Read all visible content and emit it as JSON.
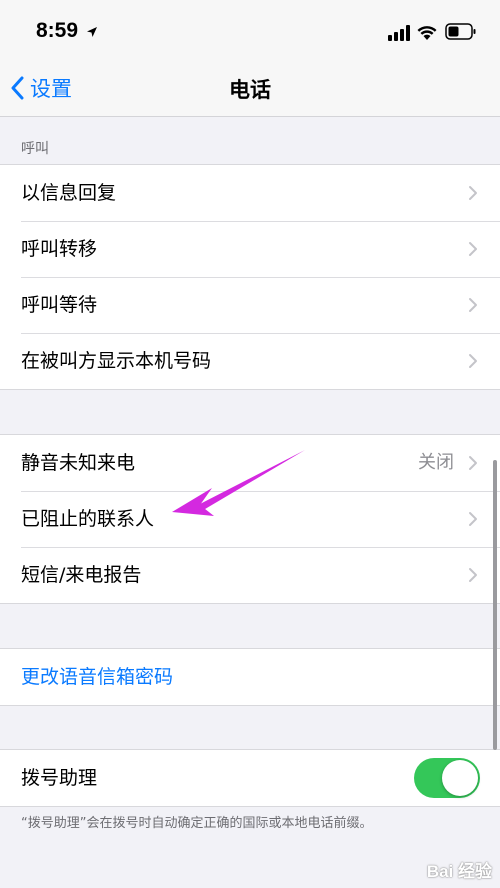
{
  "status": {
    "time": "8:59"
  },
  "nav": {
    "back_label": "设置",
    "title": "电话"
  },
  "section_call": {
    "header": "呼叫",
    "items": [
      {
        "label": "以信息回复"
      },
      {
        "label": "呼叫转移"
      },
      {
        "label": "呼叫等待"
      },
      {
        "label": "在被叫方显示本机号码"
      }
    ]
  },
  "section_block": {
    "items": [
      {
        "label": "静音未知来电",
        "value": "关闭"
      },
      {
        "label": "已阻止的联系人"
      },
      {
        "label": "短信/来电报告"
      }
    ]
  },
  "voicemail": {
    "change_password_label": "更改语音信箱密码"
  },
  "dial_assist": {
    "label": "拨号助理",
    "enabled": true,
    "note": "“拨号助理”会在拨号时自动确定正确的国际或本地电话前缀。"
  },
  "watermark": {
    "text": "Bai 经验"
  },
  "colors": {
    "accent": "#0a7aff",
    "toggle_on": "#34c759",
    "annotation_arrow": "#d429e0"
  }
}
